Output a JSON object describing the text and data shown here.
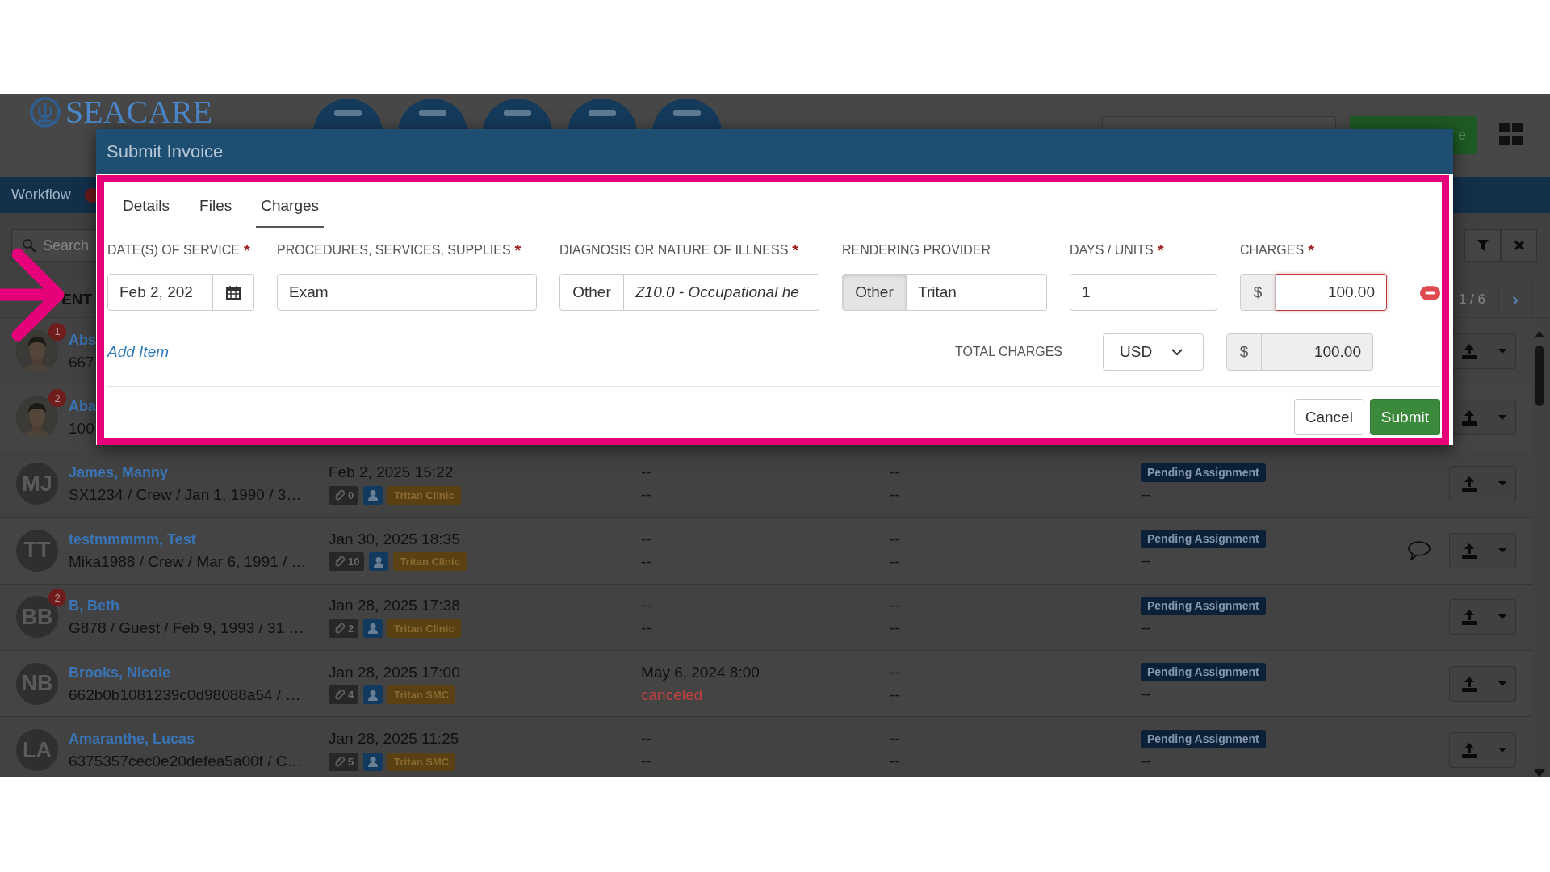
{
  "app": {
    "logo": "SEACARE",
    "header_button": "e",
    "nav_tab": "Workflow",
    "search_placeholder": "Search",
    "list_header": "ENT",
    "pagination": "1 / 6",
    "next": "›",
    "rows": [
      {
        "badge": "1",
        "name": "Abs",
        "detail": "667"
      },
      {
        "badge": "2",
        "name": "Aba",
        "detail": "100"
      },
      {
        "kind": "initials",
        "initials": "MJ",
        "name": "James, Manny",
        "detail": "SX1234 / Crew / Jan 1, 1990 / 3…",
        "date": "Feb 2, 2025 15:22",
        "count": "0",
        "clinic": "Tritan Clinic",
        "visit": [
          {
            "text": "--",
            "kind": "plain"
          },
          {
            "text": "--",
            "kind": "plain"
          }
        ],
        "col4": [
          "--",
          "--"
        ],
        "status": "Pending Assignment",
        "status_note": "--",
        "chat": false
      },
      {
        "kind": "initials",
        "initials": "TT",
        "name": "testmmmmm, Test",
        "detail": "Mika1988 / Crew / Mar 6, 1991 / …",
        "date": "Jan 30, 2025 18:35",
        "count": "10",
        "clinic": "Tritan Clinic",
        "visit": [
          {
            "text": "--",
            "kind": "plain"
          },
          {
            "text": "--",
            "kind": "plain"
          }
        ],
        "col4": [
          "--",
          "--"
        ],
        "status": "Pending Assignment",
        "status_note": "--",
        "chat": true
      },
      {
        "kind": "initials",
        "initials": "BB",
        "badge": "2",
        "name": "B, Beth",
        "detail": "G878 / Guest / Feb 9, 1993 / 31 …",
        "date": "Jan 28, 2025 17:38",
        "count": "2",
        "clinic": "Tritan Clinic",
        "visit": [
          {
            "text": "--",
            "kind": "plain"
          },
          {
            "text": "--",
            "kind": "plain"
          }
        ],
        "col4": [
          "--",
          "--"
        ],
        "status": "Pending Assignment",
        "status_note": "--",
        "chat": false
      },
      {
        "kind": "initials",
        "initials": "NB",
        "name": "Brooks, Nicole",
        "detail": "662b0b1081239c0d98088a54 / …",
        "date": "Jan 28, 2025 17:00",
        "count": "4",
        "clinic": "Tritan SMC",
        "visit": [
          {
            "text": "May 6, 2024 8:00",
            "kind": "plain"
          },
          {
            "text": "canceled",
            "kind": "alert"
          }
        ],
        "col4": [
          "--",
          "--"
        ],
        "status": "Pending Assignment",
        "status_note": "--",
        "chat": false
      },
      {
        "kind": "initials",
        "initials": "LA",
        "name": "Amaranthe, Lucas",
        "detail": "6375357cec0e20defea5a00f / C…",
        "date": "Jan 28, 2025 11:25",
        "count": "5",
        "clinic": "Tritan SMC",
        "visit": [
          {
            "text": "--",
            "kind": "plain"
          },
          {
            "text": "--",
            "kind": "plain"
          }
        ],
        "col4": [
          "--",
          "--"
        ],
        "status": "Pending Assignment",
        "status_note": "--",
        "chat": false
      }
    ]
  },
  "modal": {
    "title": "Submit Invoice",
    "tabs": [
      {
        "label": "Details",
        "selected": false
      },
      {
        "label": "Files",
        "selected": false
      },
      {
        "label": "Charges",
        "selected": true
      }
    ],
    "fields": [
      {
        "kind": "date",
        "label": "DATE(S) OF SERVICE",
        "required_mark": "*",
        "value": "Feb 2, 202"
      },
      {
        "kind": "text",
        "label": "PROCEDURES, SERVICES, SUPPLIES",
        "required_mark": "*",
        "value": "Exam"
      },
      {
        "kind": "diagnosis",
        "label": "DIAGNOSIS OR NATURE OF ILLNESS",
        "required_mark": "*",
        "addon": {
          "label": "Other",
          "selected": false
        },
        "value": "Z10.0 - Occupational he"
      },
      {
        "kind": "provider",
        "label": "RENDERING PROVIDER",
        "addon": {
          "label": "Other",
          "selected": true
        },
        "value": "Tritan"
      },
      {
        "kind": "text",
        "label": "DAYS / UNITS",
        "required_mark": "*",
        "value": "1"
      },
      {
        "kind": "money",
        "label": "CHARGES",
        "required_mark": "*",
        "symbol": "$",
        "value": "100.00",
        "invalid": true
      }
    ],
    "add_item": "Add Item",
    "total": {
      "label": "TOTAL CHARGES",
      "currency": "USD",
      "symbol": "$",
      "value": "100.00"
    },
    "buttons": [
      {
        "label": "Cancel",
        "kind": "secondary"
      },
      {
        "label": "Submit",
        "kind": "primary"
      }
    ]
  }
}
